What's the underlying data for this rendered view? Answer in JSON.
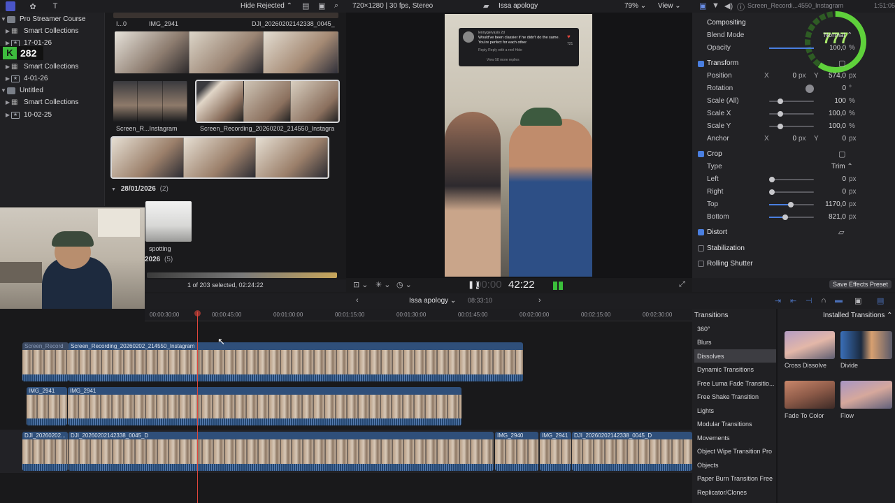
{
  "library": {
    "library_name": "Pro Streamer Course",
    "items": [
      {
        "label": "Smart Collections",
        "kind": "smart"
      },
      {
        "label": "17-01-26",
        "kind": "event"
      },
      {
        "label": "Smart Collections",
        "kind": "smart"
      },
      {
        "label": "4-01-26",
        "kind": "event"
      },
      {
        "label": "Untitled",
        "kind": "library"
      },
      {
        "label": "Smart Collections",
        "kind": "smart"
      },
      {
        "label": "10-02-25",
        "kind": "event"
      }
    ],
    "stream_counter": "282"
  },
  "browser": {
    "filter": "Hide Rejected",
    "clip_labels_top": [
      "I...0",
      "IMG_2941",
      "DJI_20260202142338_0045_"
    ],
    "clip_labels_mid": [
      "Screen_R...Instagram",
      "Screen_Recording_20260202_214550_Instagra"
    ],
    "date_group": {
      "label": "28/01/2026",
      "count": "(2)"
    },
    "spotting_label": "spotting",
    "year_group": {
      "label": "2026",
      "count": "(5)"
    },
    "status": "1 of 203 selected, 02:24:22"
  },
  "viewer": {
    "format": "720×1280 | 30 fps, Stereo",
    "project": "Issa apology",
    "zoom": "79%",
    "view_menu": "View",
    "timecode_dim": "00:00",
    "timecode": "42:22",
    "overlay_comment": {
      "user": "lennygervasio 2d",
      "text": "Would've been classier if he didn't do the same. You're perfect for each other",
      "likes": "721",
      "actions": "Reply   Reply with a reel   Hide",
      "replies": "View 58 more replies"
    }
  },
  "inspector": {
    "clip_name": "Screen_Recordi...4550_Instagram",
    "time": "1:51:05",
    "compositing": "Compositing",
    "blend_mode": {
      "label": "Blend Mode",
      "value": "Normal"
    },
    "opacity": {
      "label": "Opacity",
      "value": "100,0",
      "unit": "%"
    },
    "transform": {
      "title": "Transform",
      "position": {
        "label": "Position",
        "x_label": "X",
        "x": "0",
        "x_unit": "px",
        "y_label": "Y",
        "y": "574,0",
        "y_unit": "px"
      },
      "rotation": {
        "label": "Rotation",
        "value": "0",
        "unit": "°"
      },
      "scale_all": {
        "label": "Scale (All)",
        "value": "100",
        "unit": "%"
      },
      "scale_x": {
        "label": "Scale X",
        "value": "100,0",
        "unit": "%"
      },
      "scale_y": {
        "label": "Scale Y",
        "value": "100,0",
        "unit": "%"
      },
      "anchor": {
        "label": "Anchor",
        "x_label": "X",
        "x": "0",
        "x_unit": "px",
        "y_label": "Y",
        "y": "0",
        "y_unit": "px"
      }
    },
    "crop": {
      "title": "Crop",
      "type": {
        "label": "Type",
        "value": "Trim"
      },
      "left": {
        "label": "Left",
        "value": "0",
        "unit": "px"
      },
      "right": {
        "label": "Right",
        "value": "0",
        "unit": "px"
      },
      "top": {
        "label": "Top",
        "value": "1170,0",
        "unit": "px"
      },
      "bottom": {
        "label": "Bottom",
        "value": "821,0",
        "unit": "px"
      }
    },
    "distort": "Distort",
    "stabilization": "Stabilization",
    "rolling_shutter": "Rolling Shutter",
    "save_preset": "Save Effects Preset",
    "stream_score": "777"
  },
  "timeline": {
    "project": "Issa apology",
    "duration": "08:33:10",
    "ruler": [
      "00:00:30:00",
      "00:00:45:00",
      "00:01:00:00",
      "00:01:15:00",
      "00:01:30:00",
      "00:01:45:00",
      "00:02:00:00",
      "00:02:15:00",
      "00:02:30:00"
    ],
    "clips": {
      "top_a": "Screen_Record",
      "top_b": "Screen_Recording_20260202_214550_Instagram",
      "mid_a": "IMG_2941",
      "mid_b": "IMG_2941",
      "bot_a": "DJI_20260202...",
      "bot_b": "DJI_20260202142338_0045_D",
      "bot_c": "IMG_2940",
      "bot_d": "IMG_2941",
      "bot_e": "DJI_20260202142338_0045_D"
    }
  },
  "transitions": {
    "title": "Transitions",
    "installed": "Installed Transitions",
    "categories": [
      "360°",
      "Blurs",
      "Dissolves",
      "Dynamic Transitions",
      "Free Luma Fade Transitio...",
      "Free Shake Transition",
      "Lights",
      "Modular Transitions",
      "Movements",
      "Object Wipe Transition Pro",
      "Objects",
      "Paper Burn Transition Free",
      "Replicator/Clones"
    ],
    "selected_index": 2,
    "items": [
      "Cross Dissolve",
      "Divide",
      "Fade To Color",
      "Flow"
    ]
  },
  "colors": {
    "accent": "#4a7fe0",
    "playhead": "#e0463c",
    "clip": "#2f4f7a",
    "ring": "#5fd13b"
  }
}
